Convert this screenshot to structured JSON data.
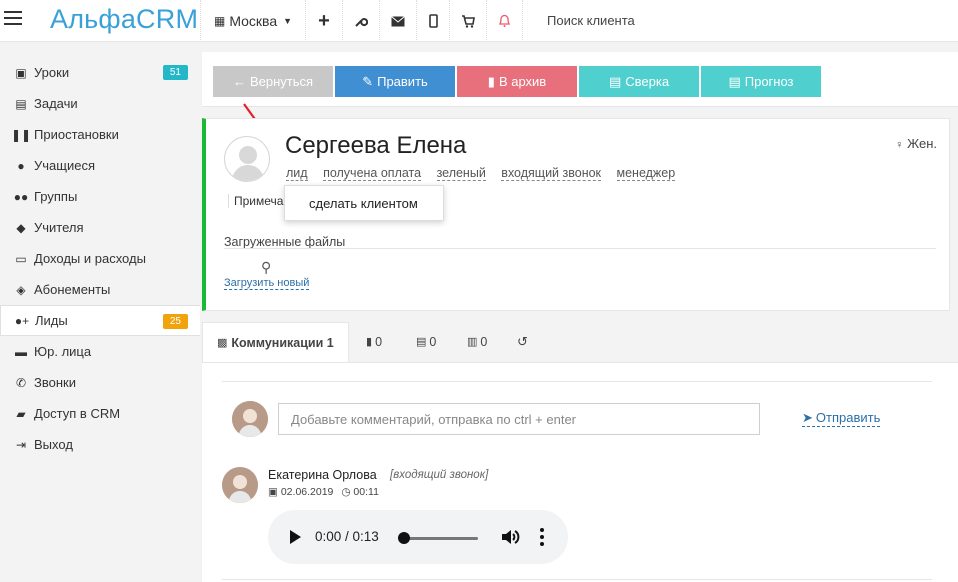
{
  "header": {
    "logo": "АльфаCRM",
    "city": "Москва",
    "search_label": "Поиск клиента",
    "icons": [
      "plus-icon",
      "wrench-icon",
      "envelope-icon",
      "mobile-icon",
      "cart-icon",
      "bell-icon"
    ]
  },
  "sidebar": {
    "items": [
      {
        "label": "Уроки",
        "icon": "calendar-icon",
        "badge": "51",
        "badge_color": "#23b7c7"
      },
      {
        "label": "Задачи",
        "icon": "clipboard-icon"
      },
      {
        "label": "Приостановки",
        "icon": "pause-icon"
      },
      {
        "label": "Учащиеся",
        "icon": "user-icon"
      },
      {
        "label": "Группы",
        "icon": "users-icon"
      },
      {
        "label": "Учителя",
        "icon": "graduation-cap-icon"
      },
      {
        "label": "Доходы и расходы",
        "icon": "money-icon"
      },
      {
        "label": "Абонементы",
        "icon": "tag-icon"
      },
      {
        "label": "Лиды",
        "icon": "user-plus-icon",
        "badge": "25",
        "badge_color": "#f0a30a",
        "active": true
      },
      {
        "label": "Юр. лица",
        "icon": "briefcase-icon"
      },
      {
        "label": "Звонки",
        "icon": "phone-icon"
      },
      {
        "label": "Доступ в CRM",
        "icon": "lock-icon"
      },
      {
        "label": "Выход",
        "icon": "sign-out-icon"
      }
    ]
  },
  "toolbar": {
    "back": "Вернуться",
    "edit": "Править",
    "archive": "В архив",
    "reconcile": "Сверка",
    "forecast": "Прогноз",
    "colors": {
      "back": "#c8c8c8",
      "edit": "#3f8fd2",
      "archive": "#e8707c",
      "reconcile": "#4fd0cf",
      "forecast": "#4fd0cf"
    }
  },
  "profile": {
    "name": "Сергеева Елена",
    "gender": "Жен.",
    "tags": [
      "лид",
      "получена оплата",
      "зеленый",
      "входящий звонок",
      "менеджер"
    ],
    "note_label": "Примечан",
    "popup_item": "сделать клиентом",
    "files_title": "Загруженные файлы",
    "upload_label": "Загрузить новый"
  },
  "tabs": [
    {
      "label": "Коммуникации 1",
      "icon": "comments-icon"
    },
    {
      "label": "0",
      "icon": "bookmark-icon"
    },
    {
      "label": "0",
      "icon": "clipboard-icon"
    },
    {
      "label": "0",
      "icon": "bar-chart-icon"
    },
    {
      "label": "",
      "icon": "history-icon"
    }
  ],
  "communications": {
    "placeholder": "Добавьте комментарий, отправка по ctrl + enter",
    "send_label": "Отправить",
    "entry": {
      "author": "Екатерина Орлова",
      "type": "[входящий звонок]",
      "date": "02.06.2019",
      "time": "00:11",
      "audio_time": "0:00 / 0:13"
    }
  }
}
